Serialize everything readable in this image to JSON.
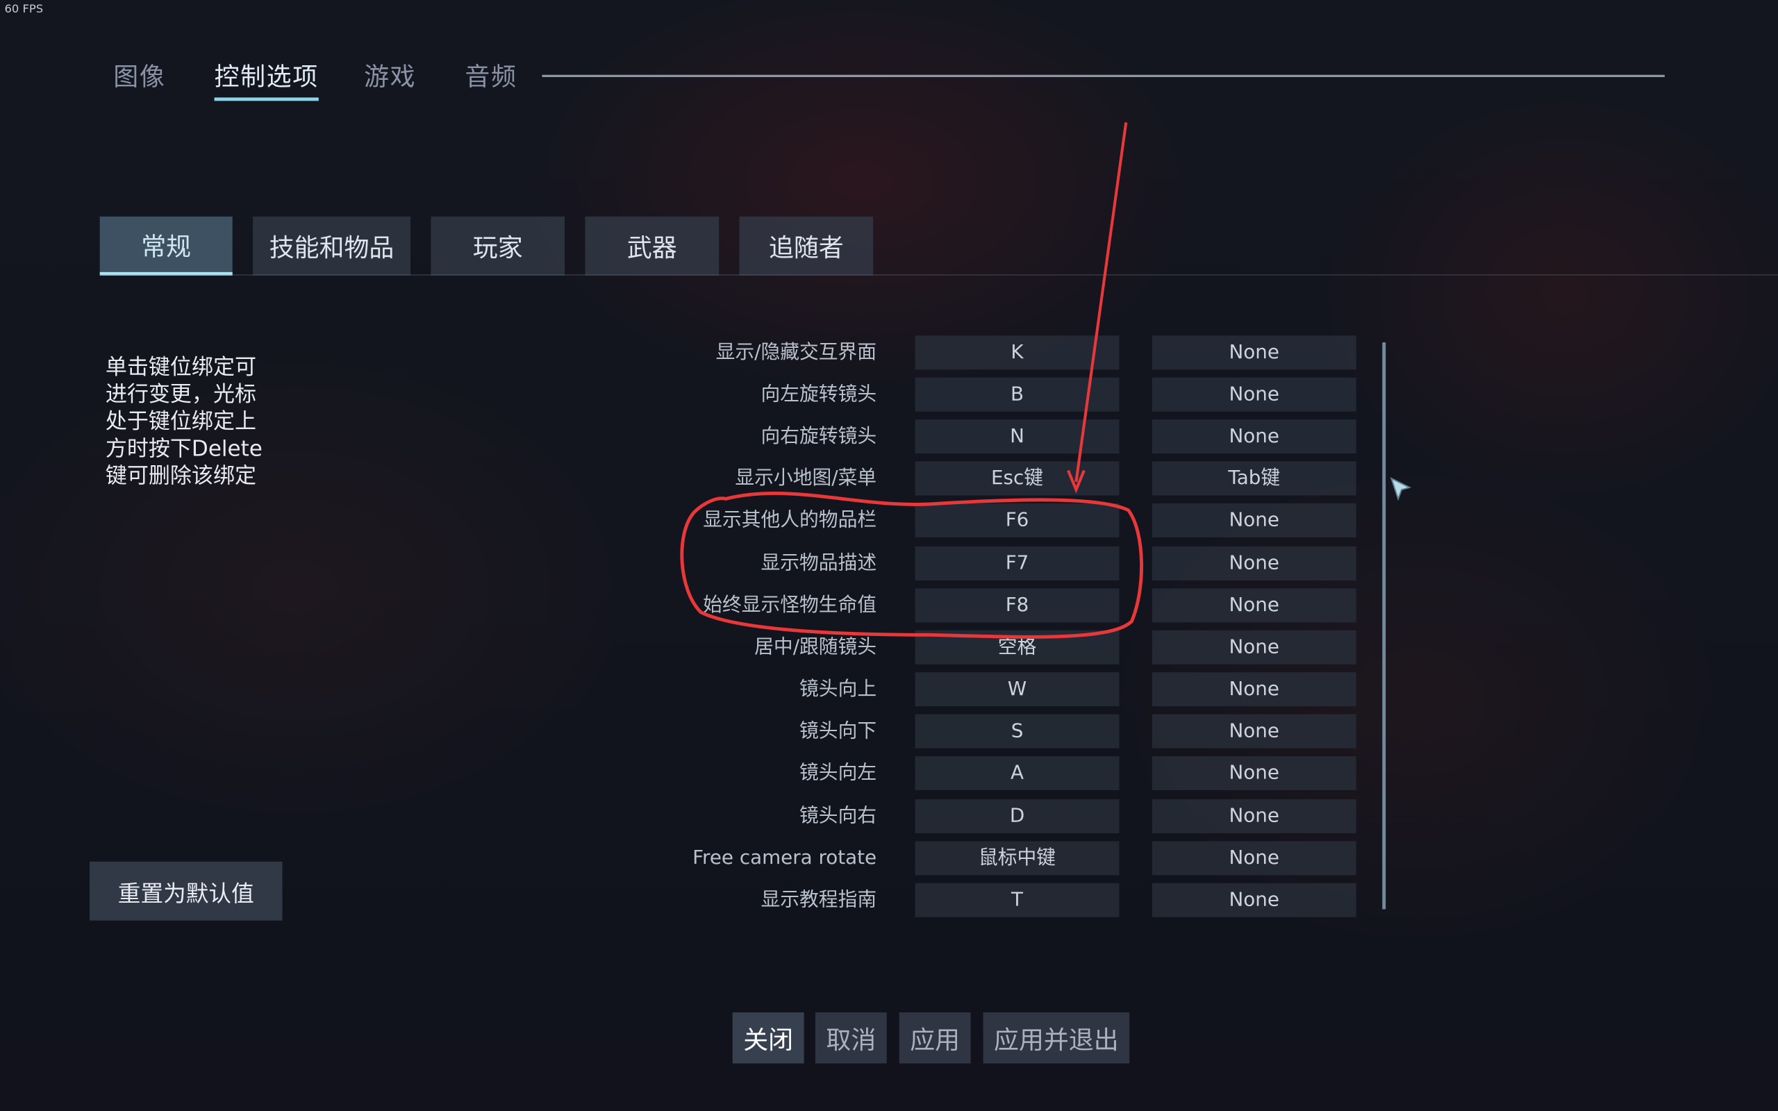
{
  "fps": "60 FPS",
  "top_tabs": [
    "图像",
    "控制选项",
    "游戏",
    "音频"
  ],
  "sub_tabs": [
    "常规",
    "技能和物品",
    "玩家",
    "武器",
    "追随者"
  ],
  "help_text": [
    "单击键位绑定可",
    "进行变更，光标",
    "处于键位绑定上",
    "方时按下Delete",
    "键可删除该绑定"
  ],
  "bindings": [
    {
      "label": "显示/隐藏交互界面",
      "primary": "K",
      "secondary": "None"
    },
    {
      "label": "向左旋转镜头",
      "primary": "B",
      "secondary": "None"
    },
    {
      "label": "向右旋转镜头",
      "primary": "N",
      "secondary": "None"
    },
    {
      "label": "显示小地图/菜单",
      "primary": "Esc键",
      "secondary": "Tab键"
    },
    {
      "label": "显示其他人的物品栏",
      "primary": "F6",
      "secondary": "None"
    },
    {
      "label": "显示物品描述",
      "primary": "F7",
      "secondary": "None"
    },
    {
      "label": "始终显示怪物生命值",
      "primary": "F8",
      "secondary": "None"
    },
    {
      "label": "居中/跟随镜头",
      "primary": "空格",
      "secondary": "None"
    },
    {
      "label": "镜头向上",
      "primary": "W",
      "secondary": "None"
    },
    {
      "label": "镜头向下",
      "primary": "S",
      "secondary": "None"
    },
    {
      "label": "镜头向左",
      "primary": "A",
      "secondary": "None"
    },
    {
      "label": "镜头向右",
      "primary": "D",
      "secondary": "None"
    },
    {
      "label": "Free camera rotate",
      "primary": "鼠标中键",
      "secondary": "None"
    },
    {
      "label": "显示教程指南",
      "primary": "T",
      "secondary": "None"
    }
  ],
  "reset_label": "重置为默认值",
  "footer": {
    "close": "关闭",
    "cancel": "取消",
    "apply": "应用",
    "apply_exit": "应用并退出"
  },
  "colors": {
    "accent": "#8fd3e8",
    "annotation": "#e8383a"
  }
}
